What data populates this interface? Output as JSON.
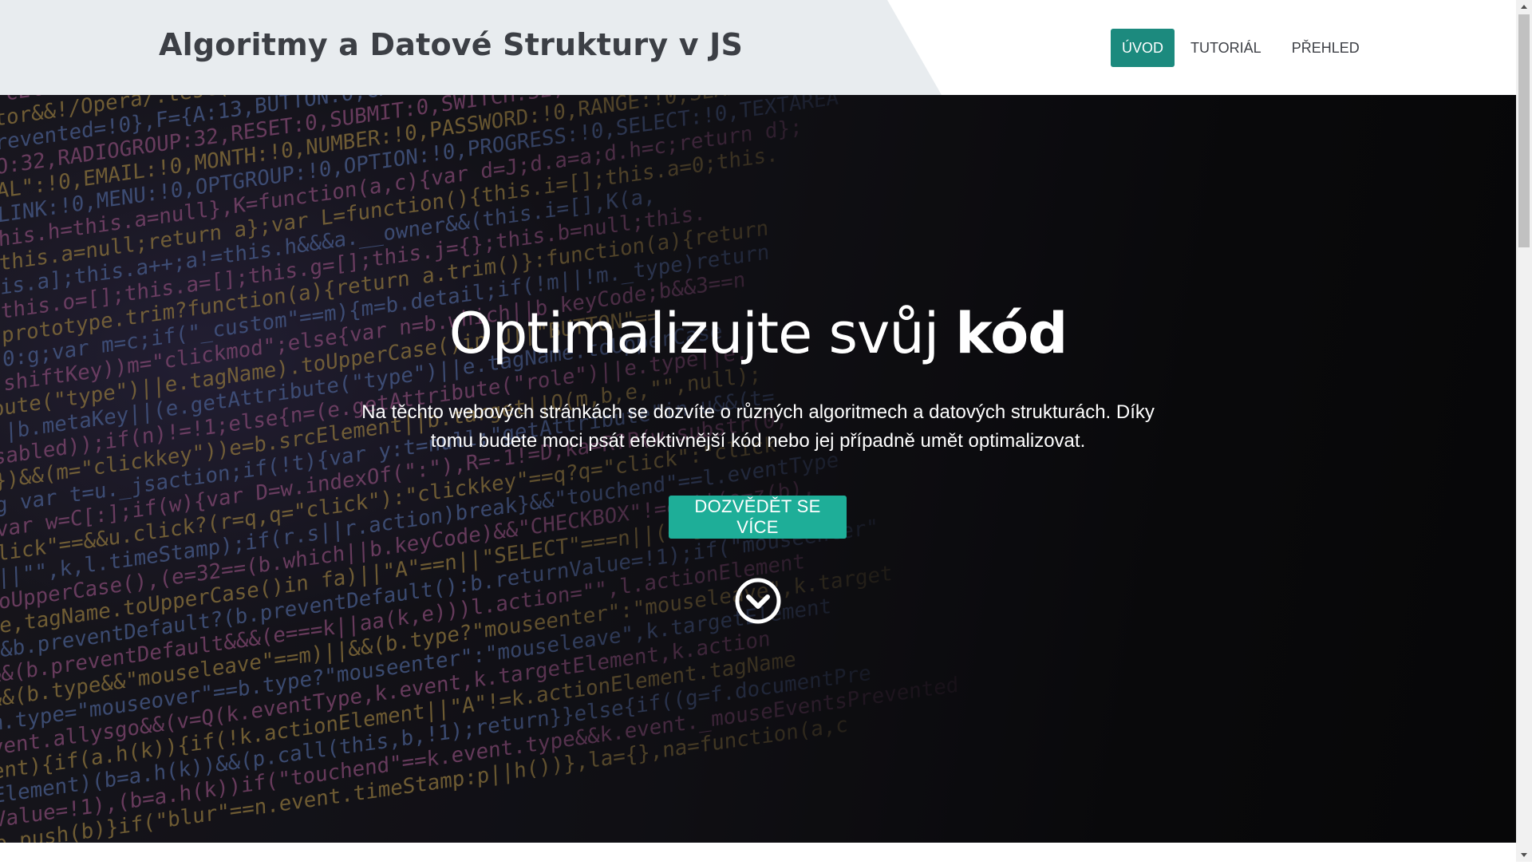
{
  "header": {
    "site_title": "Algoritmy a Datové Struktury v JS",
    "nav": [
      {
        "label": "ÚVOD",
        "active": true
      },
      {
        "label": "TUTORIÁL",
        "active": false
      },
      {
        "label": "PŘEHLED",
        "active": false
      }
    ]
  },
  "hero": {
    "title_regular": "Optimalizujte svůj ",
    "title_bold": "kód",
    "description": "Na těchto webových stránkách se dozvíte o různých algoritmech a datových strukturách. Díky tomu budete moci psát efektivnější kód nebo jej případně umět optimalizovat.",
    "cta_label": "DOZVĚDĚT SE VÍCE",
    "scroll_icon": "chevron-circle-down-icon"
  },
  "colors": {
    "accent_active_nav": "#1c8a7e",
    "cta_button": "#1eae98",
    "header_band": "#e8ecef",
    "title_text": "#3c3f45"
  }
}
